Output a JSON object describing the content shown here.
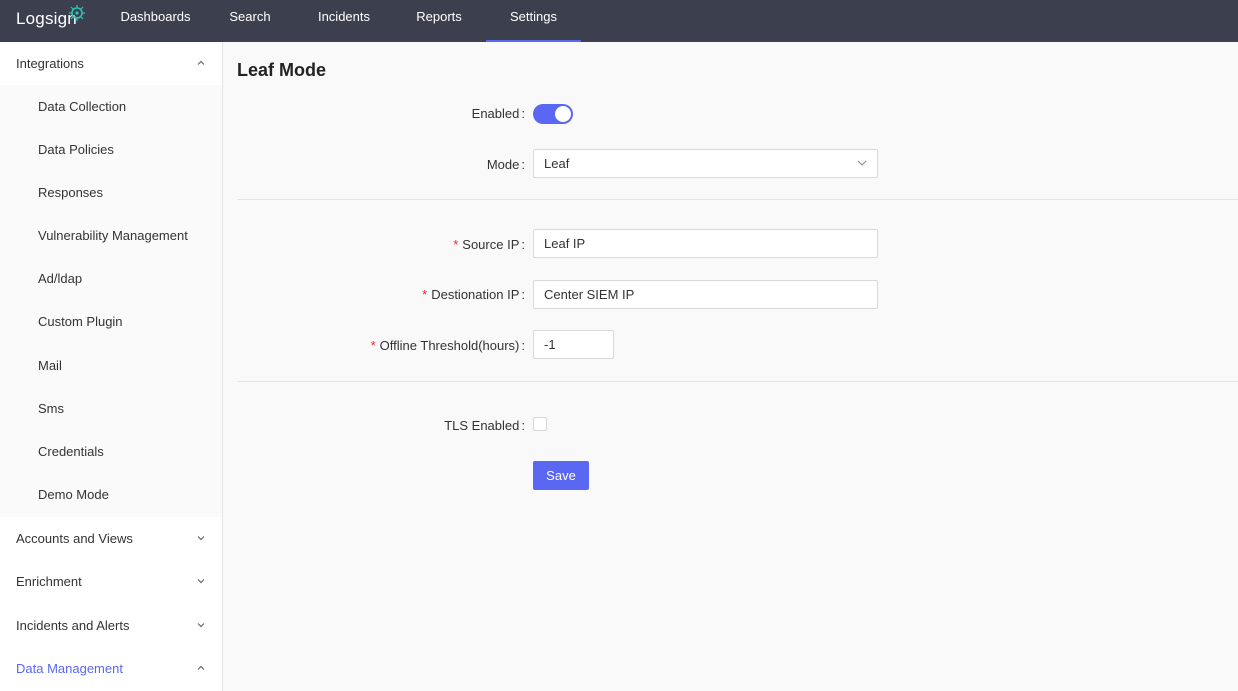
{
  "brand": {
    "logo_text": "Logsign",
    "accent": "#5a67f2",
    "topbar_bg": "#3c404e"
  },
  "nav": {
    "items": [
      {
        "label": "Dashboards"
      },
      {
        "label": "Search"
      },
      {
        "label": "Incidents"
      },
      {
        "label": "Reports"
      },
      {
        "label": "Settings",
        "active": true
      }
    ]
  },
  "sidebar": {
    "integrations": {
      "label": "Integrations",
      "expanded": true,
      "items": [
        {
          "label": "Data Collection"
        },
        {
          "label": "Data Policies"
        },
        {
          "label": "Responses"
        },
        {
          "label": "Vulnerability Management"
        },
        {
          "label": "Ad/ldap"
        },
        {
          "label": "Custom Plugin"
        },
        {
          "label": "Mail"
        },
        {
          "label": "Sms"
        },
        {
          "label": "Credentials"
        },
        {
          "label": "Demo Mode"
        }
      ]
    },
    "groups": [
      {
        "label": "Accounts and Views",
        "expanded": false
      },
      {
        "label": "Enrichment",
        "expanded": false
      },
      {
        "label": "Incidents and Alerts",
        "expanded": false
      },
      {
        "label": "Data Management",
        "expanded": true,
        "active": true
      }
    ]
  },
  "page": {
    "title": "Leaf Mode",
    "enabled_label": "Enabled",
    "enabled_value": true,
    "mode_label": "Mode",
    "mode_value": "Leaf",
    "source_ip_label": "Source IP",
    "source_ip_placeholder": "Leaf IP",
    "destination_ip_label": "Destionation IP",
    "destination_ip_placeholder": "Center SIEM IP",
    "offline_threshold_label": "Offline Threshold(hours)",
    "offline_threshold_value": "-1",
    "tls_label": "TLS Enabled",
    "tls_value": false,
    "save_label": "Save",
    "colon": ":",
    "required_mark": "*"
  }
}
